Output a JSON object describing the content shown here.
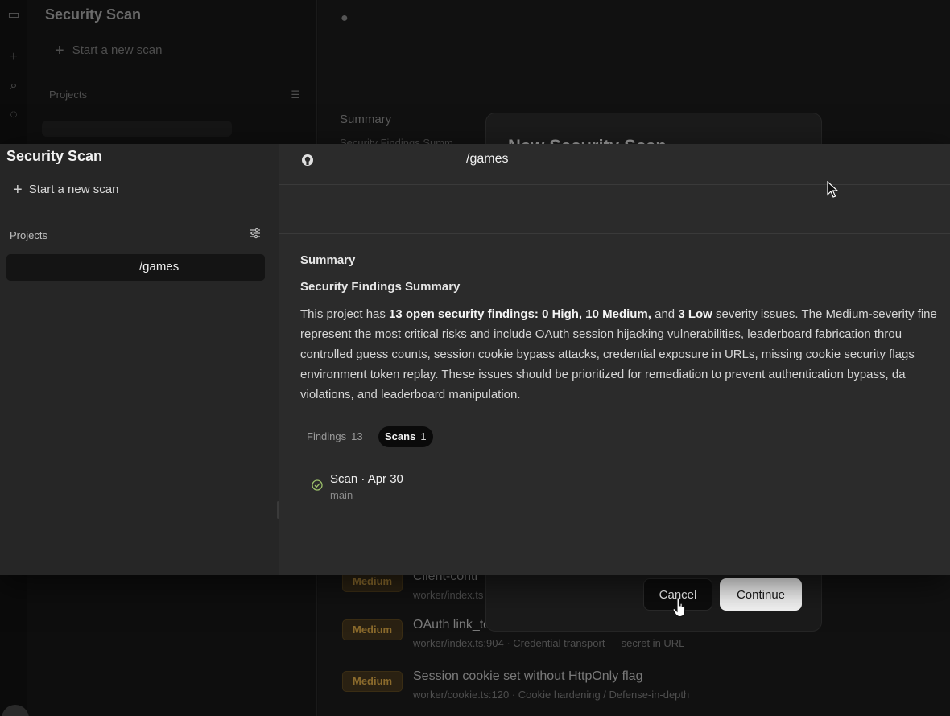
{
  "app": {
    "title": "Security Scan",
    "new_scan_label": "Start a new scan",
    "projects_label": "Projects",
    "project_name": "/games"
  },
  "repo": {
    "name": "/games"
  },
  "summary": {
    "heading": "Summary",
    "subheading": "Security Findings Summary",
    "line1_a": "This project has ",
    "line1_b": "13 open security findings: 0 High, 10 Medium,",
    "line1_c": " and ",
    "line1_d": "3 Low",
    "line1_e": " severity issues. The Medium-severity fine",
    "line2": "represent the most critical risks and include OAuth session hijacking vulnerabilities, leaderboard fabrication throu",
    "line3": "controlled guess counts, session cookie bypass attacks, credential exposure in URLs, missing cookie security flags",
    "line4": "environment token replay. These issues should be prioritized for remediation to prevent authentication bypass, da",
    "line5": "violations, and leaderboard manipulation."
  },
  "tabs": {
    "findings_label": "Findings",
    "findings_count": "13",
    "scans_label": "Scans",
    "scans_count": "1"
  },
  "scan": {
    "title": "Scan · Apr 30",
    "branch": "main"
  },
  "background": {
    "modal_title": "New Security Scan",
    "sfs_label": "Security Findings Summ",
    "findings": [
      {
        "severity": "Medium",
        "title": "Client-contr",
        "meta": "worker/index.ts"
      },
      {
        "severity": "Medium",
        "title": "OAuth link_to",
        "meta": "worker/index.ts:904 · Credential transport — secret in URL"
      },
      {
        "severity": "Medium",
        "title": "Session cookie set without HttpOnly flag",
        "meta": "worker/cookie.ts:120 · Cookie hardening / Defense-in-depth"
      }
    ],
    "cancel_label": "Cancel",
    "continue_label": "Continue"
  },
  "colors": {
    "medium_badge": "#8a6a2c",
    "scan_ok": "#9bbf6a"
  }
}
